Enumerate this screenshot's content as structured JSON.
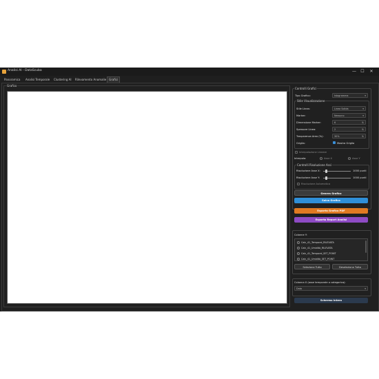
{
  "window": {
    "title": "Analisi AI - DataScuba",
    "min": "—",
    "max": "☐",
    "close": "✕"
  },
  "tabs": [
    "Panoramica",
    "Analisi Temporale",
    "Clustering AI",
    "Rilevamento Anomalie",
    "Grafici"
  ],
  "graph_group": {
    "label": "Grafico"
  },
  "controls": {
    "group_label": "Controlli Grafici",
    "type_label": "Tipo Grafico:",
    "type_value": "Istogramma",
    "style_group": "Stile Visualizzazione",
    "line_style_label": "Stile Linea:",
    "line_style_value": "Linea Solida",
    "marker_label": "Marker:",
    "marker_value": "Nessuno",
    "marker_size_label": "Dimensione Marker:",
    "marker_size_value": "6",
    "line_width_label": "Spessore Linea:",
    "line_width_value": "2",
    "area_alpha_label": "Trasparenza Area (%):",
    "area_alpha_value": "30%",
    "grid_label": "Griglia:",
    "grid_check_label": "Mostra Griglia",
    "linear_interp_label": "Interpolazione Lineare",
    "interp_label": "Interpola:",
    "axis_x_label": "Asse X",
    "axis_y_label": "Asse Y",
    "axis_res_group": "Controlli Risoluzione Assi",
    "res_x_label": "Risoluzione Asse X:",
    "res_x_value": "1000 punti",
    "res_y_label": "Risoluzione Asse Y:",
    "res_y_value": "1000 punti",
    "auto_res_label": "Risoluzione Automatica",
    "res_x_level": 0.1,
    "res_y_level": 0.1
  },
  "buttons": {
    "generate": "Genera Grafico",
    "save": "Salva Grafico",
    "export_pdf": "Esporta Grafico PDF",
    "export_report": "Esporta Report Analisi",
    "select_all": "Seleziona Tutto",
    "deselect_all": "Deseleziona Tutto",
    "refresh": "Schermo Intero"
  },
  "colors": {
    "save": "#2f8fd8",
    "export_pdf": "#e07a22",
    "export_report": "#8e4bc4",
    "generate": "#3a3a3a",
    "refresh": "#2b3a4e"
  },
  "columns_y": {
    "label": "Colonne Y:",
    "items": [
      "Calc_41_Temporal_RILEVATA",
      "Calc_41_Umidità_RILEVATA",
      "Calc_41_Temporal_SET_POINT",
      "Calc_41_Umidità_SET_POINT"
    ]
  },
  "column_x": {
    "label": "Colonna X (asse temporale o categorica):",
    "value": "Data"
  }
}
